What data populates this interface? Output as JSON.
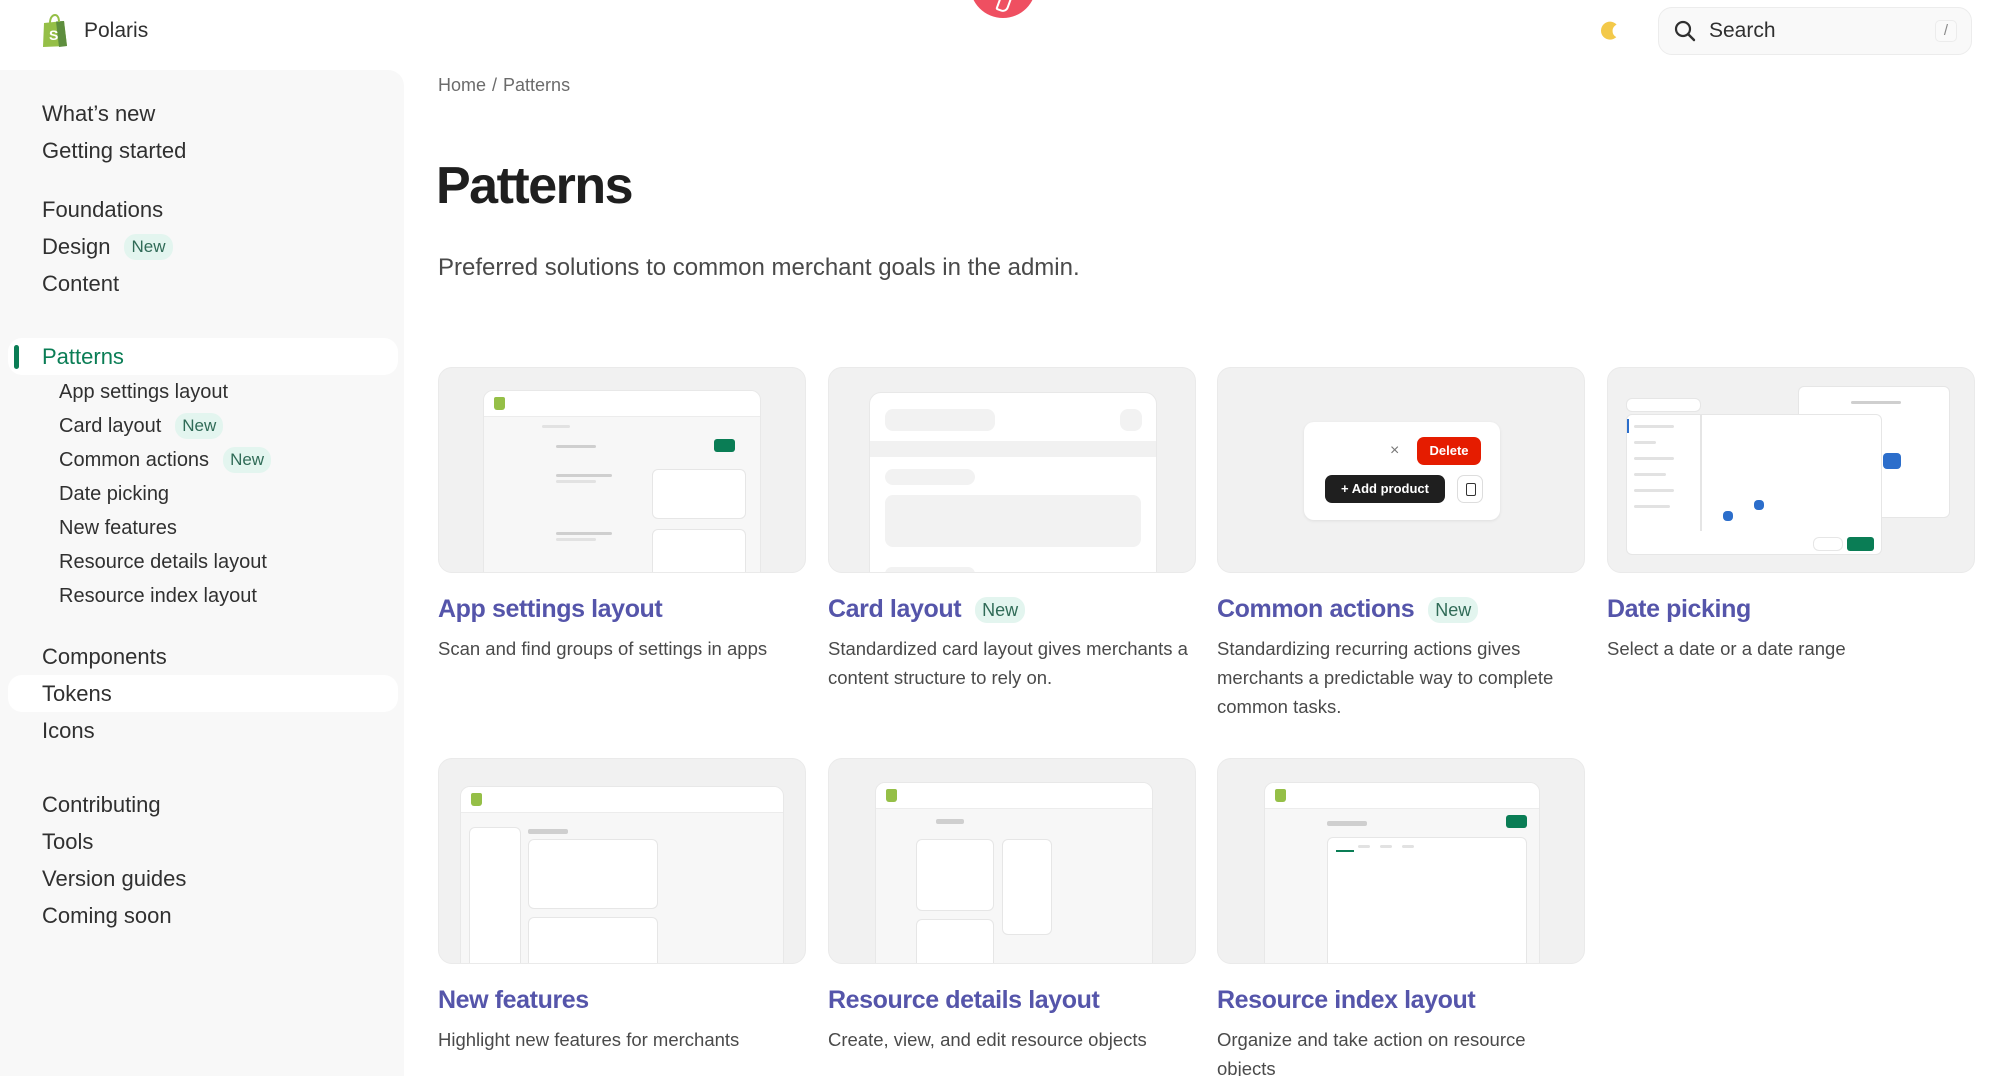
{
  "header": {
    "brand": "Polaris",
    "search_label": "Search",
    "search_shortcut": "/",
    "theme_icon": "moon-icon"
  },
  "sidebar": {
    "groups": [
      {
        "items": [
          {
            "label": "What’s new"
          },
          {
            "label": "Getting started"
          }
        ]
      },
      {
        "items": [
          {
            "label": "Foundations"
          },
          {
            "label": "Design",
            "badge": "New"
          },
          {
            "label": "Content"
          }
        ]
      },
      {
        "items": [
          {
            "label": "Patterns",
            "active": true
          }
        ],
        "sub_items": [
          {
            "label": "App settings layout"
          },
          {
            "label": "Card layout",
            "badge": "New"
          },
          {
            "label": "Common actions",
            "badge": "New"
          },
          {
            "label": "Date picking"
          },
          {
            "label": "New features"
          },
          {
            "label": "Resource details layout"
          },
          {
            "label": "Resource index layout"
          }
        ]
      },
      {
        "items": [
          {
            "label": "Components"
          },
          {
            "label": "Tokens",
            "hover": true
          },
          {
            "label": "Icons"
          }
        ]
      },
      {
        "items": [
          {
            "label": "Contributing"
          },
          {
            "label": "Tools"
          },
          {
            "label": "Version guides"
          },
          {
            "label": "Coming soon"
          }
        ]
      }
    ]
  },
  "breadcrumb": {
    "home": "Home",
    "separator": "/",
    "current": "Patterns"
  },
  "page": {
    "title": "Patterns",
    "subtitle": "Preferred solutions to common merchant goals in the admin."
  },
  "cards": [
    {
      "title": "App settings layout",
      "description": "Scan and find groups of settings in apps"
    },
    {
      "title": "Card layout",
      "badge": "New",
      "description": "Standardized card layout gives merchants a content structure to rely on."
    },
    {
      "title": "Common actions",
      "badge": "New",
      "description": "Standardizing recurring actions gives merchants a predictable way to complete common tasks.",
      "preview": {
        "close": "×",
        "delete": "Delete",
        "add": "+ Add product"
      }
    },
    {
      "title": "Date picking",
      "description": "Select a date or a date range"
    },
    {
      "title": "New features",
      "description": "Highlight new features for merchants"
    },
    {
      "title": "Resource details layout",
      "description": "Create, view, and edit resource objects"
    },
    {
      "title": "Resource index layout",
      "description": "Organize and take action on resource objects"
    }
  ],
  "colors": {
    "accent_green": "#0a7d55",
    "link_purple": "#5555aa",
    "badge_bg": "#e3f5ef",
    "delete_red": "#e51c00"
  }
}
